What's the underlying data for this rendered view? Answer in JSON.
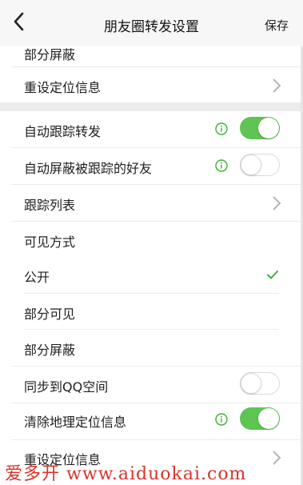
{
  "header": {
    "title": "朋友圈转发设置",
    "save_label": "保存"
  },
  "rows": {
    "partial_block_top": "部分屏蔽",
    "reset_location_top": "重设定位信息",
    "auto_follow_forward": "自动跟踪转发",
    "auto_block_friends": "自动屏蔽被跟踪的好友",
    "follow_list": "跟踪列表",
    "visibility_mode": "可见方式",
    "public": "公开",
    "partial_visible": "部分可见",
    "partial_block": "部分屏蔽",
    "sync_qq_space": "同步到QQ空间",
    "clear_location": "清除地理定位信息",
    "reset_location_bottom": "重设定位信息"
  },
  "toggles": {
    "auto_follow_forward": true,
    "auto_block_friends": false,
    "sync_qq_space": false,
    "clear_location": true
  },
  "icons": {
    "back": "back-chevron-icon",
    "info": "info-circle-icon",
    "chevron": "chevron-right-icon",
    "check": "checkmark-icon"
  },
  "colors": {
    "accent_green": "#5ec454",
    "info_green": "#3cb034",
    "watermark_red": "#d8342b"
  },
  "watermark": "爱多开 www.aiduokai.com"
}
